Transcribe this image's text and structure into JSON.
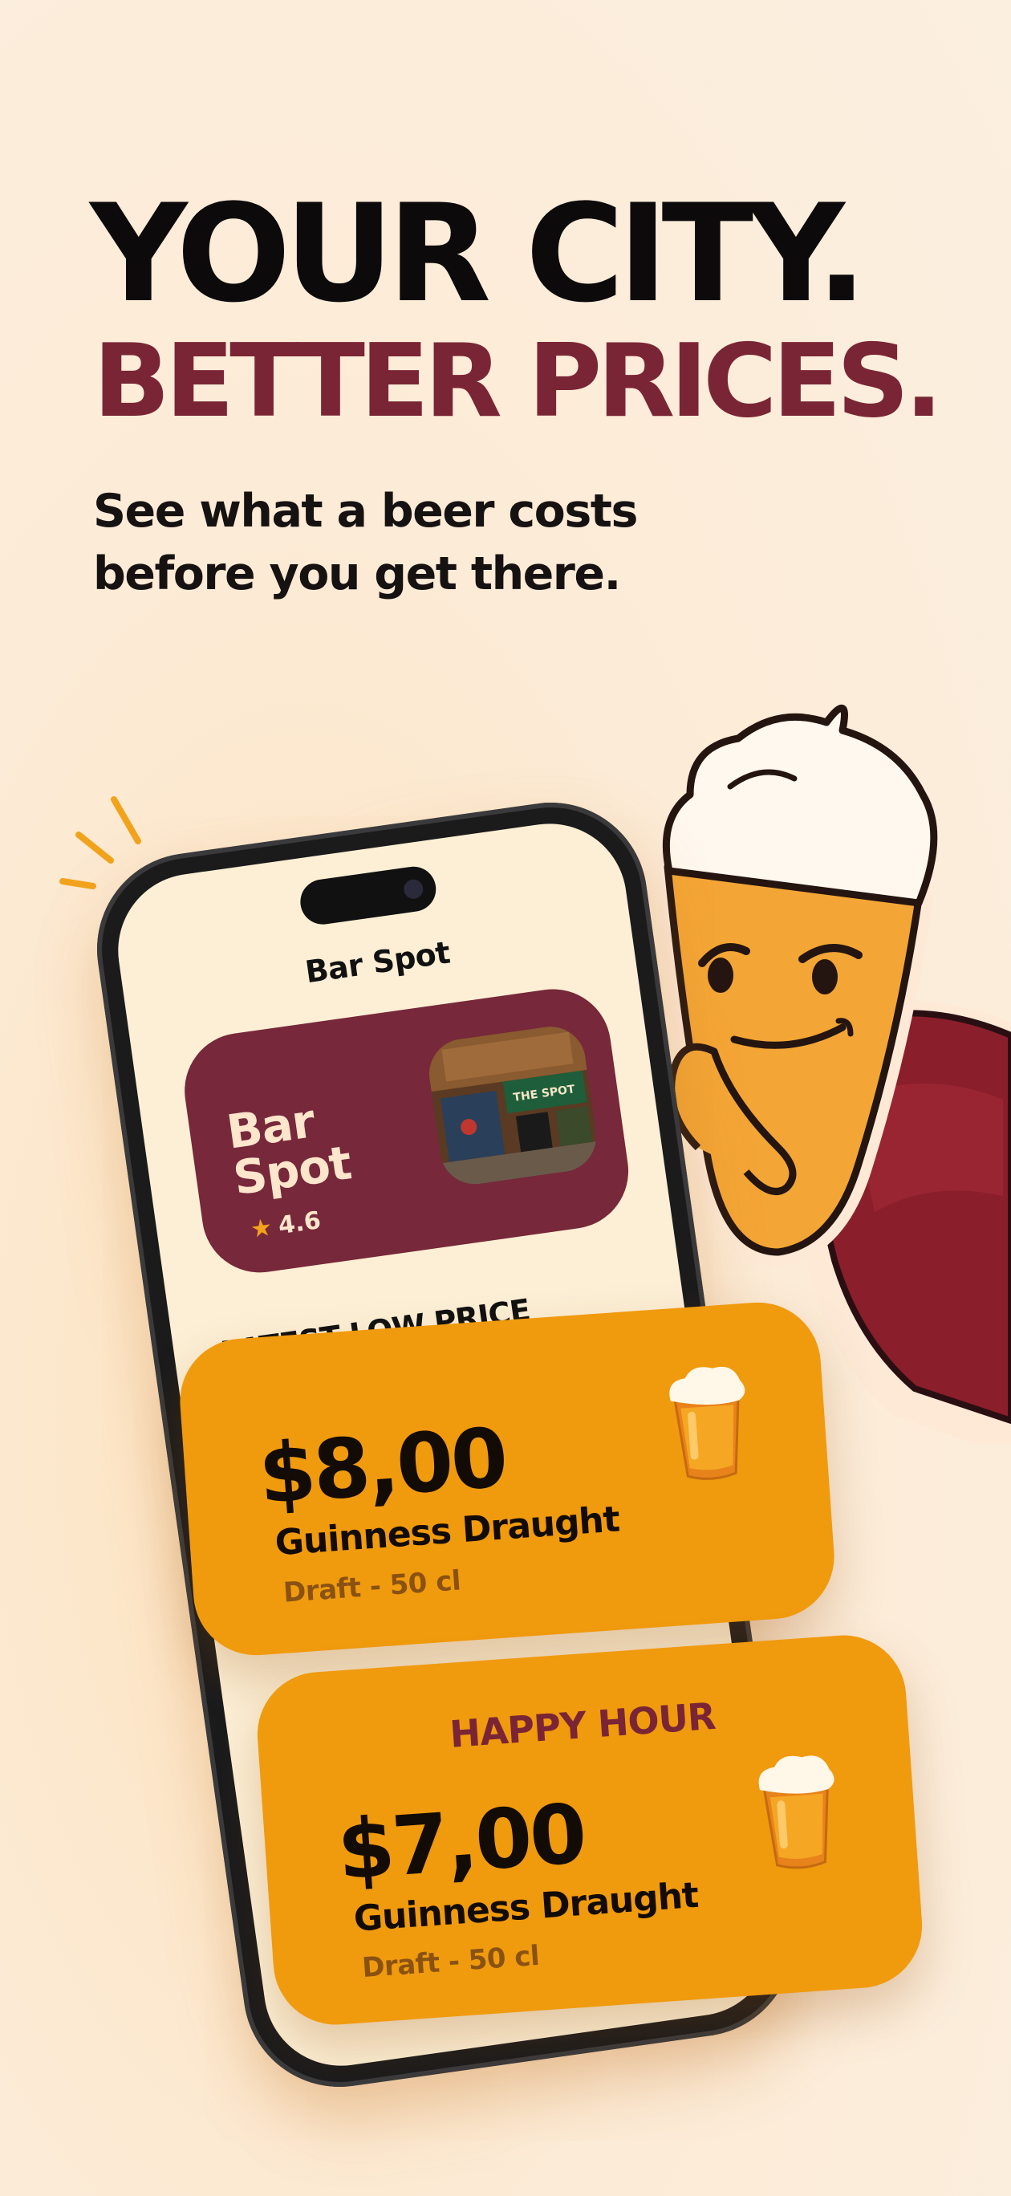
{
  "headline": {
    "line1": "YOUR CITY.",
    "line2": "BETTER PRICES."
  },
  "subtitle": "See what a beer costs before you get there.",
  "phone": {
    "screen_title": "Bar Spot",
    "bar_card": {
      "name": "Bar Spot",
      "rating": "4.6",
      "rating_icon": "star-icon",
      "photo_sign_text": "THE SPOT"
    },
    "section_label": "LATEST LOW PRICE"
  },
  "cards": [
    {
      "price": "$8,00",
      "beer": "Guinness Draught",
      "serving": "Draft - 50 cl",
      "icon": "beer-glass-icon"
    },
    {
      "tag": "HAPPY HOUR",
      "price": "$7,00",
      "beer": "Guinness Draught",
      "serving": "Draft - 50 cl",
      "icon": "beer-glass-icon"
    }
  ],
  "colors": {
    "background": "#fbefe0",
    "brand_maroon": "#7a2535",
    "card_orange": "#f09a0e",
    "text_dark": "#0c0a0a"
  }
}
